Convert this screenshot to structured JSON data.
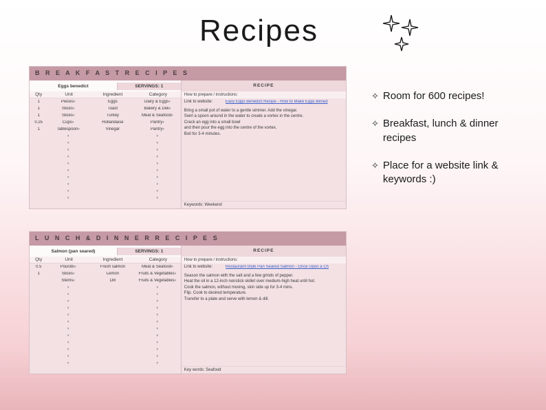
{
  "title": "Recipes",
  "bullets": [
    "Room for 600 recipes!",
    "Breakfast, lunch & dinner recipes",
    "Place for a website link & keywords :)"
  ],
  "cards": [
    {
      "header": "B R E A K F A S T  R E C I P E S",
      "recipe_name": "Eggs benedict",
      "servings_label": "SERVINGS:",
      "servings": "1",
      "columns": {
        "qty": "Qty",
        "unit": "Unit",
        "ingredient": "Ingredient",
        "category": "Category"
      },
      "ingredients": [
        {
          "qty": "1",
          "unit": "Pieces",
          "ingredient": "Eggs",
          "category": "Dairy & Eggs"
        },
        {
          "qty": "1",
          "unit": "Slices",
          "ingredient": "Toast",
          "category": "Bakery & Deli"
        },
        {
          "qty": "1",
          "unit": "Slices",
          "ingredient": "Turkey",
          "category": "Meat & Seafood"
        },
        {
          "qty": "0.25",
          "unit": "Cups",
          "ingredient": "Hollandaise",
          "category": "Pantry"
        },
        {
          "qty": "1",
          "unit": "Tablespoon",
          "ingredient": "Vinegar",
          "category": "Pantry"
        }
      ],
      "recipe_label": "RECIPE",
      "how_to": "How to prepare / instructions:",
      "link_label": "Link to website:",
      "link_text": "Easy Eggs Benedict Recipe - How to Make Eggs Bened",
      "instructions": [
        "Bring a small pot of water to a gentle simmer. Add the vinegar.",
        "Swirl a spoon around in the water to create a vortex in the centre.",
        "Crack an egg into a small bowl",
        "and then pour the egg into the centre of the vortex.",
        "Boil for 3-4 minutes."
      ],
      "keywords_label": "Keywords:",
      "keywords": "Weekend"
    },
    {
      "header": "L U N C H  &  D I N N E R  R E C I P E S",
      "recipe_name": "Salmon (pan seared)",
      "servings_label": "SERVINGS:",
      "servings": "1",
      "columns": {
        "qty": "Qty",
        "unit": "Unit",
        "ingredient": "Ingredient",
        "category": "Category"
      },
      "ingredients": [
        {
          "qty": "0.5",
          "unit": "Pounds",
          "ingredient": "Fresh salmon",
          "category": "Meat & Seafood"
        },
        {
          "qty": "1",
          "unit": "Slices",
          "ingredient": "Lemon",
          "category": "Fruits & Vegetables"
        },
        {
          "qty": "",
          "unit": "Stems",
          "ingredient": "Dill",
          "category": "Fruits & Vegetables"
        }
      ],
      "recipe_label": "RECIPE",
      "how_to": "How to prepare / instructions:",
      "link_label": "Link to website:",
      "link_text": "Restaurant-Style Pan Seared Salmon - Once Upon a Ch",
      "instructions": [
        "Season the salmon with the salt and a few grinds of pepper.",
        "Heat the oil in a 12-inch nonstick skillet over medium-high heat until hot.",
        "Cook the salmon, without moving, skin side up for 3-4 mins.",
        "Flip. Cook to desired temperature.",
        "Transfer to a plate and serve with lemon & dill."
      ],
      "keywords_label": "Key words:",
      "keywords": "Seafood"
    }
  ]
}
